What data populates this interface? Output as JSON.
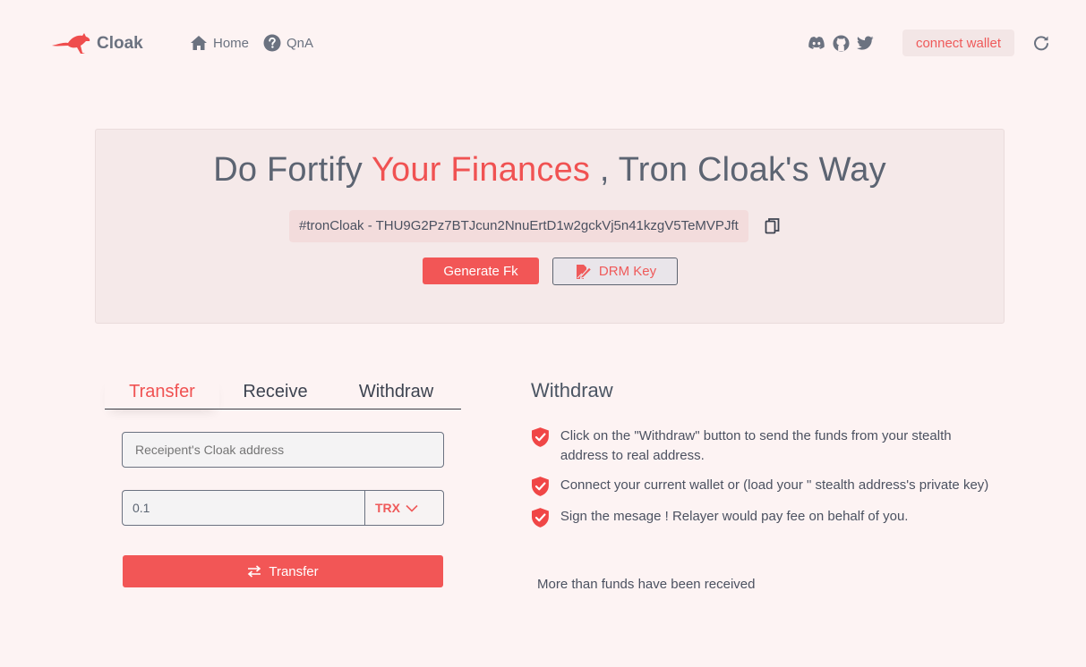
{
  "header": {
    "logo_text": "Cloak",
    "nav": [
      {
        "label": "Home",
        "icon": "home-icon"
      },
      {
        "label": "QnA",
        "icon": "question-icon"
      }
    ],
    "social_icons": [
      "discord-icon",
      "github-icon",
      "twitter-icon"
    ],
    "connect_label": "connect wallet"
  },
  "hero": {
    "title_pre": "Do Fortify ",
    "title_accent": "Your Finances",
    "title_post": " , Tron Cloak's Way",
    "address": "#tronCloak - THU9G2Pz7BTJcun2NnuErtD1w2gckVj5n41kzgV5TeMVPJft",
    "generate_label": "Generate Fk",
    "drm_label": "DRM Key"
  },
  "tabs": [
    {
      "label": "Transfer",
      "active": true
    },
    {
      "label": "Receive",
      "active": false
    },
    {
      "label": "Withdraw",
      "active": false
    }
  ],
  "form": {
    "recipient_placeholder": "Receipent's Cloak address",
    "amount_value": "0.1",
    "token": "TRX",
    "submit_label": "Transfer"
  },
  "info": {
    "title": "Withdraw",
    "items": [
      "Click on the \"Withdraw\" button to send the funds from your stealth address to real address.",
      "Connect your current wallet or (load your \" stealth address's private key)",
      "Sign the mesage ! Relayer would pay fee on behalf of you."
    ],
    "note": "More than funds have been received"
  },
  "colors": {
    "accent": "#f05252",
    "background": "#fdf3f3",
    "text": "#5b6472"
  }
}
